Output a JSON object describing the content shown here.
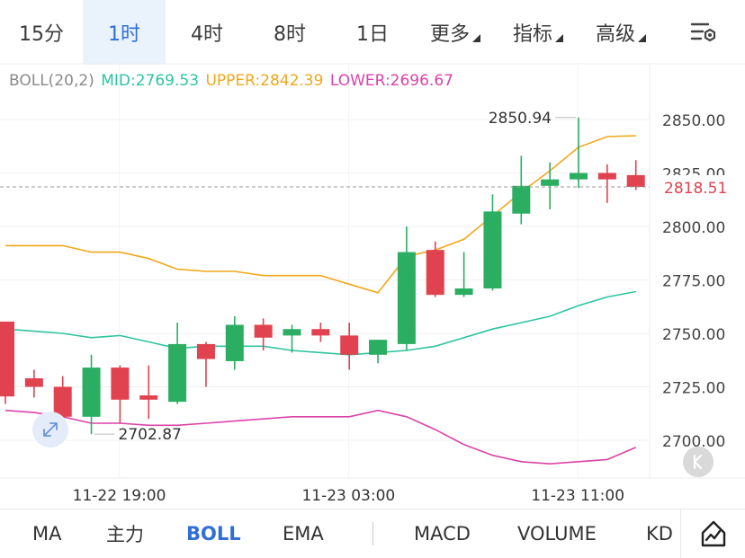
{
  "period_tabs": [
    {
      "label": "15分",
      "active": false,
      "dropdown": false
    },
    {
      "label": "1时",
      "active": true,
      "dropdown": false
    },
    {
      "label": "4时",
      "active": false,
      "dropdown": false
    },
    {
      "label": "8时",
      "active": false,
      "dropdown": false
    },
    {
      "label": "1日",
      "active": false,
      "dropdown": false
    },
    {
      "label": "更多",
      "active": false,
      "dropdown": true
    },
    {
      "label": "指标",
      "active": false,
      "dropdown": true
    },
    {
      "label": "高级",
      "active": false,
      "dropdown": true
    }
  ],
  "settings_icon": "chart-settings-icon",
  "legend": {
    "name": "BOLL(20,2)",
    "mid": "MID:2769.53",
    "upper": "UPPER:2842.39",
    "lower": "LOWER:2696.67"
  },
  "colors": {
    "up": "#2bad62",
    "down": "#e0424f",
    "mid": "#2ec4a0",
    "upper": "#f0a81a",
    "lower": "#d943a8",
    "accent": "#2f6fd6",
    "current_price": "#e0424f"
  },
  "chart_data": {
    "type": "candlestick",
    "y_ticks": [
      "2850.00",
      "2825.00",
      "2800.00",
      "2775.00",
      "2750.00",
      "2725.00",
      "2700.00"
    ],
    "ylim": [
      2688.0,
      2866.0
    ],
    "x_tick_labels": [
      {
        "label": "11-22 19:00",
        "index": 3.0
      },
      {
        "label": "11-23 03:00",
        "index": 11.0
      },
      {
        "label": "11-23 11:00",
        "index": 19.0
      }
    ],
    "grid": true,
    "candles": [
      {
        "o": 2755.5,
        "h": 2755.5,
        "l": 2717.0,
        "c": 2720.5
      },
      {
        "o": 2729.0,
        "h": 2733.0,
        "l": 2720.0,
        "c": 2725.0
      },
      {
        "o": 2725.0,
        "h": 2730.0,
        "l": 2703.0,
        "c": 2711.0
      },
      {
        "o": 2711.0,
        "h": 2740.0,
        "l": 2702.87,
        "c": 2734.0
      },
      {
        "o": 2734.0,
        "h": 2735.0,
        "l": 2708.0,
        "c": 2719.0
      },
      {
        "o": 2721.0,
        "h": 2735.0,
        "l": 2710.0,
        "c": 2719.0
      },
      {
        "o": 2718.0,
        "h": 2755.0,
        "l": 2717.0,
        "c": 2745.0
      },
      {
        "o": 2745.0,
        "h": 2746.0,
        "l": 2725.0,
        "c": 2738.0
      },
      {
        "o": 2737.0,
        "h": 2758.0,
        "l": 2733.0,
        "c": 2754.0
      },
      {
        "o": 2754.0,
        "h": 2757.0,
        "l": 2742.0,
        "c": 2748.0
      },
      {
        "o": 2749.0,
        "h": 2754.0,
        "l": 2741.0,
        "c": 2752.0
      },
      {
        "o": 2752.0,
        "h": 2755.0,
        "l": 2746.0,
        "c": 2749.0
      },
      {
        "o": 2749.0,
        "h": 2755.0,
        "l": 2733.0,
        "c": 2740.0
      },
      {
        "o": 2740.0,
        "h": 2747.0,
        "l": 2736.0,
        "c": 2747.0
      },
      {
        "o": 2745.0,
        "h": 2800.0,
        "l": 2742.0,
        "c": 2788.0
      },
      {
        "o": 2789.0,
        "h": 2793.0,
        "l": 2767.0,
        "c": 2768.0
      },
      {
        "o": 2768.0,
        "h": 2788.0,
        "l": 2767.0,
        "c": 2771.0
      },
      {
        "o": 2771.0,
        "h": 2815.0,
        "l": 2770.0,
        "c": 2807.0
      },
      {
        "o": 2806.0,
        "h": 2833.0,
        "l": 2801.0,
        "c": 2819.0
      },
      {
        "o": 2819.0,
        "h": 2830.0,
        "l": 2808.0,
        "c": 2822.0
      },
      {
        "o": 2822.0,
        "h": 2850.94,
        "l": 2818.0,
        "c": 2825.0
      },
      {
        "o": 2825.0,
        "h": 2829.0,
        "l": 2811.0,
        "c": 2822.0
      },
      {
        "o": 2824.0,
        "h": 2831.0,
        "l": 2817.0,
        "c": 2818.51
      }
    ],
    "series": [
      {
        "name": "UPPER",
        "values": [
          2791.0,
          2791.0,
          2791.0,
          2788.0,
          2788.0,
          2785.0,
          2780.0,
          2779.0,
          2779.0,
          2777.0,
          2777.0,
          2777.0,
          2773.0,
          2769.0,
          2786.0,
          2789.0,
          2794.0,
          2805.0,
          2816.0,
          2826.0,
          2837.0,
          2842.0,
          2842.39
        ]
      },
      {
        "name": "MID",
        "values": [
          2752.0,
          2751.0,
          2750.0,
          2748.0,
          2749.0,
          2746.0,
          2743.0,
          2744.0,
          2744.0,
          2744.0,
          2742.0,
          2741.0,
          2740.0,
          2741.0,
          2742.0,
          2744.0,
          2748.0,
          2752.0,
          2755.0,
          2758.0,
          2763.0,
          2767.0,
          2769.53
        ]
      },
      {
        "name": "LOWER",
        "values": [
          2714.0,
          2713.0,
          2711.0,
          2708.0,
          2708.0,
          2707.0,
          2707.0,
          2708.0,
          2709.0,
          2710.0,
          2711.0,
          2711.0,
          2711.0,
          2714.0,
          2711.0,
          2705.0,
          2698.0,
          2693.0,
          2690.0,
          2689.0,
          2690.0,
          2691.0,
          2696.67
        ]
      }
    ],
    "high_label": "2850.94",
    "low_label": "2702.87",
    "current_price": "2818.51"
  },
  "indicator_tabs": [
    {
      "label": "MA",
      "active": false
    },
    {
      "label": "主力",
      "active": false
    },
    {
      "label": "BOLL",
      "active": true
    },
    {
      "label": "EMA",
      "active": false
    },
    {
      "label": "MACD",
      "active": false
    },
    {
      "label": "VOLUME",
      "active": false
    },
    {
      "label": "KD",
      "active": false
    }
  ],
  "draw_icon": "drawing-tool-icon",
  "collapse_icon": "double-arrow-collapse-icon",
  "scroll_left_icon": "scroll-left-icon"
}
